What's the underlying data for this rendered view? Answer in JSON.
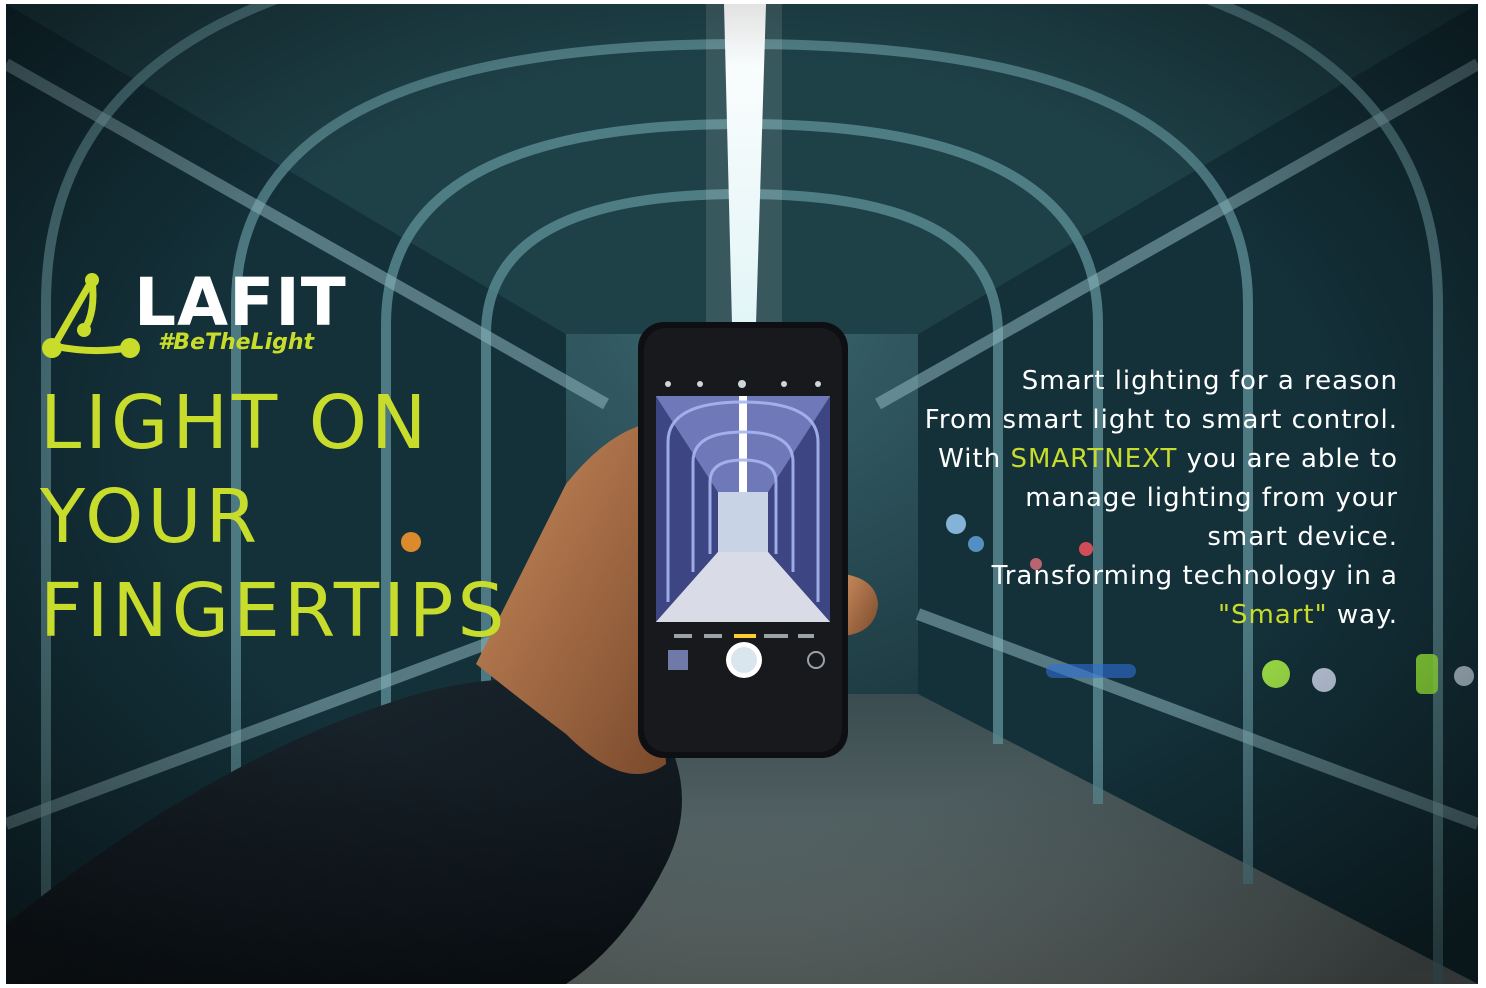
{
  "brand": {
    "name": "LAFIT",
    "tagline": "#BeTheLight",
    "accent_color": "#c8dc2c"
  },
  "headline": {
    "lines": [
      "LIGHT ON",
      "YOUR",
      "FINGERTIPS"
    ]
  },
  "copy": {
    "line1": "Smart lighting for a reason",
    "line2": "From smart light to smart control.",
    "line3_pre": "With ",
    "line3_highlight": "SMARTNEXT",
    "line3_post": " you are able to",
    "line4": "manage lighting from your",
    "line5": "smart device.",
    "line6": "Transforming technology in a",
    "line7_highlight": "\"Smart\"",
    "line7_post": " way."
  },
  "photo": {
    "subject": "hand holding smartphone photographing a lit covered walkway"
  }
}
